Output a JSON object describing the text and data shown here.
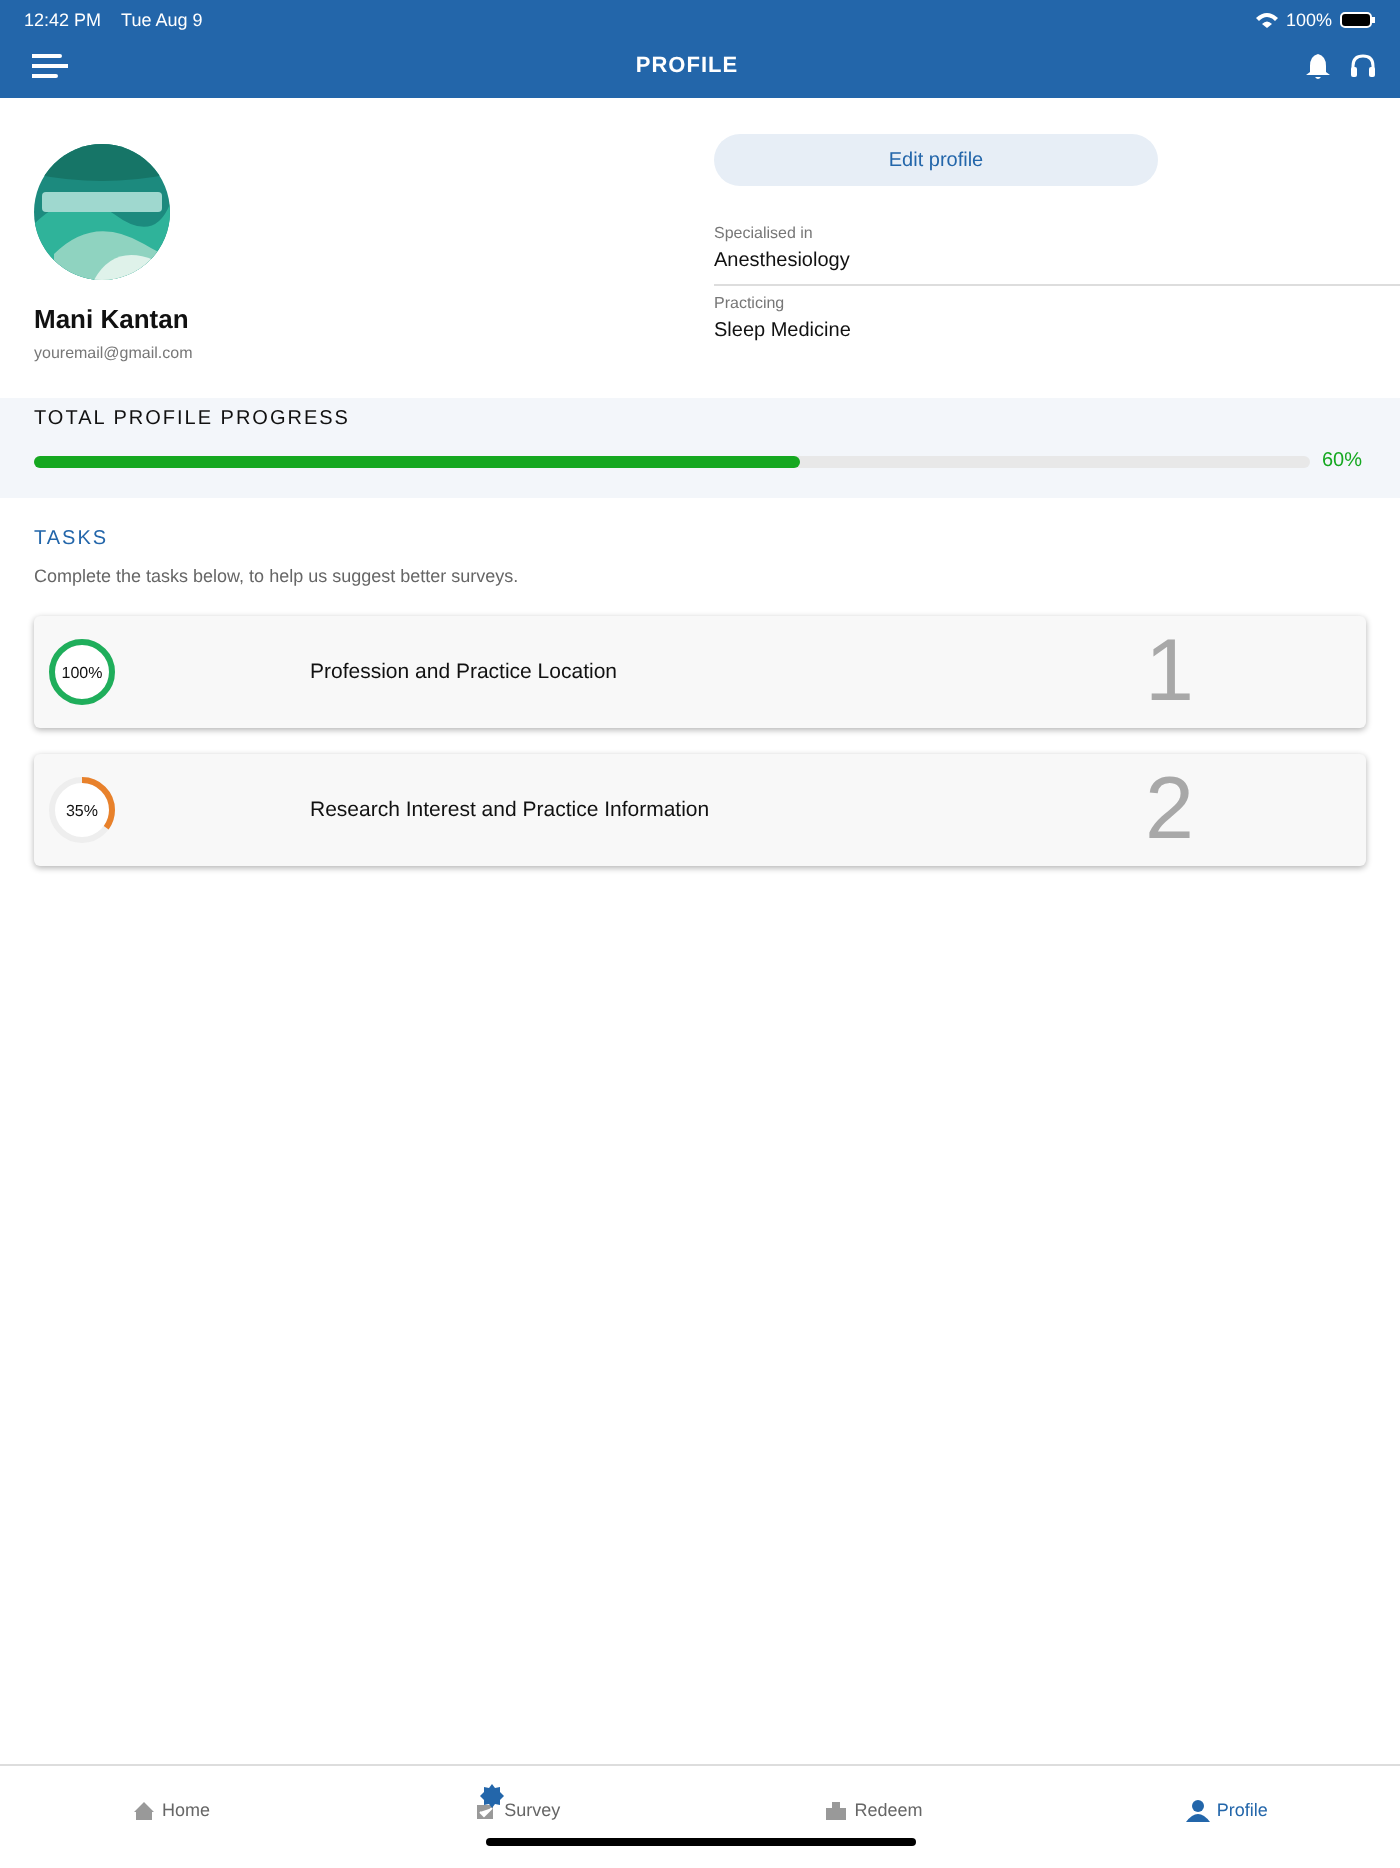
{
  "status_bar": {
    "time": "12:42 PM",
    "date": "Tue Aug 9",
    "battery": "100%"
  },
  "header": {
    "title": "PROFILE"
  },
  "profile": {
    "name": "Mani Kantan",
    "email": "youremail@gmail.com",
    "edit_button": "Edit profile",
    "fields": [
      {
        "label": "Specialised in",
        "value": "Anesthesiology"
      },
      {
        "label": "Practicing",
        "value": "Sleep Medicine"
      }
    ]
  },
  "progress": {
    "title": "TOTAL PROFILE PROGRESS",
    "level": 0.6,
    "reading": "60%"
  },
  "tasks": {
    "title": "TASKS",
    "subtitle": "Complete the tasks below, to help us suggest better surveys.",
    "items": [
      {
        "percent": "100%",
        "level": 1.0,
        "color": "#1fae5b",
        "title": "Profession and Practice Location",
        "number": "1"
      },
      {
        "percent": "35%",
        "level": 0.35,
        "color": "#e8812b",
        "title": "Research Interest and Practice Information",
        "number": "2"
      }
    ]
  },
  "tab_bar": [
    {
      "label": "Home",
      "kind": "home",
      "selected": false
    },
    {
      "label": "Survey",
      "kind": "survey",
      "selected": false,
      "badge": true
    },
    {
      "label": "Redeem",
      "kind": "redeem",
      "selected": false
    },
    {
      "label": "Profile",
      "kind": "profile",
      "selected": true
    }
  ]
}
